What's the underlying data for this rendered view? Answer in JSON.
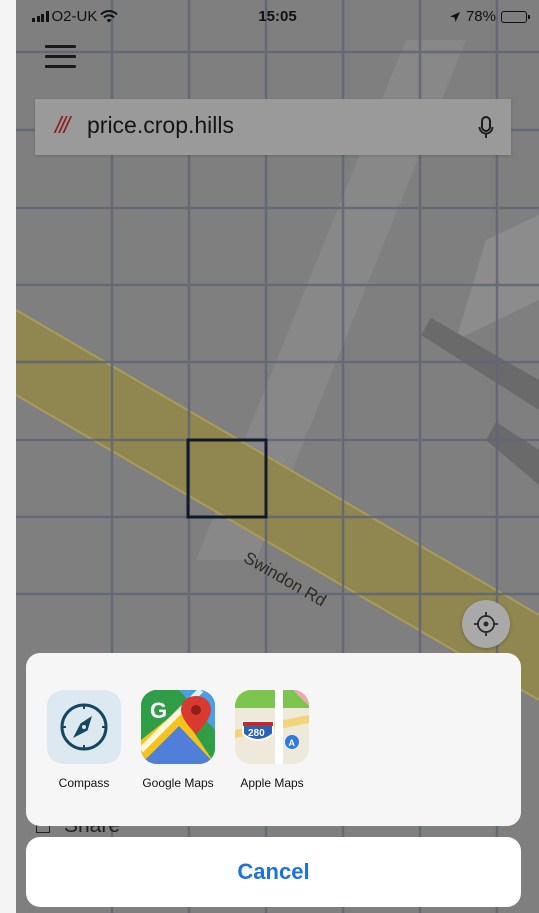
{
  "status": {
    "carrier": "O2-UK",
    "time": "15:05",
    "battery_percent": "78%",
    "battery_level": 0.78
  },
  "search": {
    "prefix": "///",
    "words": "price.crop.hills"
  },
  "map": {
    "road_label": "Swindon Rd"
  },
  "share_sheet": {
    "apps": [
      {
        "label": "Compass",
        "icon": "compass-icon"
      },
      {
        "label": "Google Maps",
        "icon": "google-maps-icon"
      },
      {
        "label": "Apple Maps",
        "icon": "apple-maps-icon"
      }
    ],
    "background_action": "Share",
    "cancel_label": "Cancel"
  },
  "colors": {
    "accent_red": "#8f1a1a",
    "cancel_blue": "#1a73e0",
    "road_fill": "#8f8650"
  }
}
